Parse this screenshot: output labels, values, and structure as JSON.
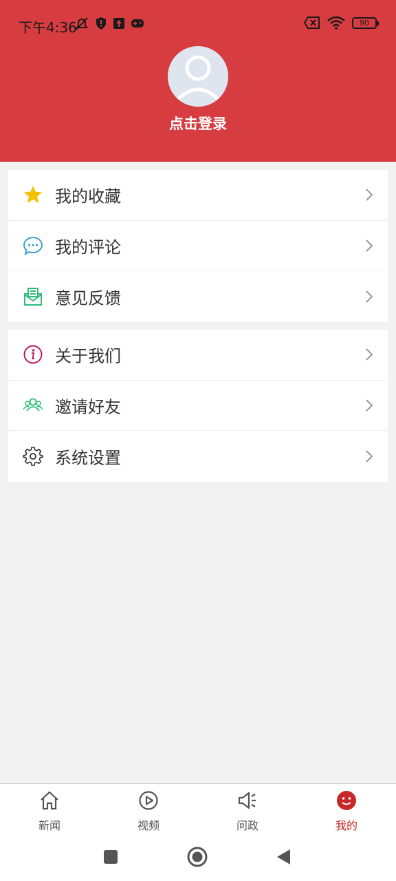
{
  "status_bar": {
    "time": "下午4:36",
    "battery": "90"
  },
  "profile": {
    "login_text": "点击登录"
  },
  "menu_group_1": [
    {
      "label": "我的收藏",
      "icon": "star-icon"
    },
    {
      "label": "我的评论",
      "icon": "comment-icon"
    },
    {
      "label": "意见反馈",
      "icon": "feedback-icon"
    }
  ],
  "menu_group_2": [
    {
      "label": "关于我们",
      "icon": "info-icon"
    },
    {
      "label": "邀请好友",
      "icon": "friends-icon"
    },
    {
      "label": "系统设置",
      "icon": "gear-icon"
    }
  ],
  "tabs": [
    {
      "label": "新闻",
      "icon": "home-icon",
      "active": false
    },
    {
      "label": "视频",
      "icon": "play-icon",
      "active": false
    },
    {
      "label": "问政",
      "icon": "megaphone-icon",
      "active": false
    },
    {
      "label": "我的",
      "icon": "smiley-icon",
      "active": true
    }
  ],
  "colors": {
    "header": "#d63c40",
    "accent": "#c62828",
    "star": "#f2c200",
    "comment": "#3aa0c8",
    "feedback": "#2ebd7a",
    "info": "#c2185b",
    "friends": "#2ebd7a"
  }
}
